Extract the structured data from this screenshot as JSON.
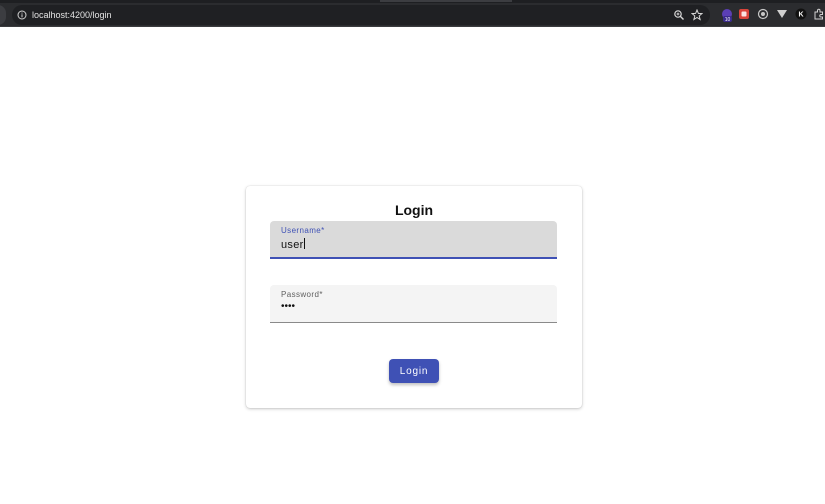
{
  "browser": {
    "url": "localhost:4200/login",
    "icons": [
      "info-icon",
      "zoom-icon",
      "bookmark-star-icon"
    ],
    "extensions": [
      {
        "name": "extension-badge-icon",
        "badge": "10"
      },
      {
        "name": "extension-red-icon"
      },
      {
        "name": "extension-circle-icon"
      },
      {
        "name": "extension-v-icon"
      },
      {
        "name": "extension-k-icon",
        "label": "K"
      },
      {
        "name": "extensions-puzzle-icon"
      }
    ]
  },
  "login": {
    "title": "Login",
    "username": {
      "label": "Username*",
      "value": "user"
    },
    "password": {
      "label": "Password*",
      "masked_value": "••••"
    },
    "submit_label": "Login"
  },
  "colors": {
    "primary": "#3f51b5",
    "page_background": "#ffffff",
    "browser_toolbar": "#2b2c2f"
  }
}
